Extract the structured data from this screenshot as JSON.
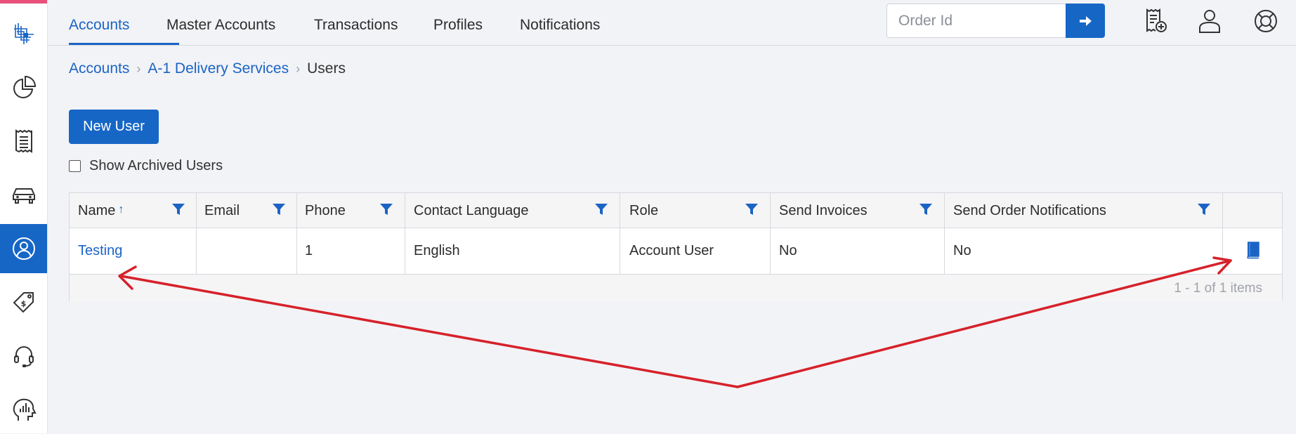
{
  "sidebar": {
    "items": [
      {
        "icon": "logo-icon"
      },
      {
        "icon": "pie-chart-icon"
      },
      {
        "icon": "receipt-icon"
      },
      {
        "icon": "car-icon"
      },
      {
        "icon": "user-circle-icon",
        "active": true
      },
      {
        "icon": "price-tag-icon"
      },
      {
        "icon": "headset-icon"
      },
      {
        "icon": "analytics-head-icon"
      }
    ]
  },
  "nav": {
    "tabs": [
      {
        "label": "Accounts",
        "active": true
      },
      {
        "label": "Master Accounts"
      },
      {
        "label": "Transactions"
      },
      {
        "label": "Profiles"
      },
      {
        "label": "Notifications"
      }
    ],
    "order_placeholder": "Order Id",
    "icons": [
      "add-receipt-icon",
      "user-icon",
      "help-lifebuoy-icon"
    ]
  },
  "breadcrumb": {
    "items": [
      "Accounts",
      "A-1 Delivery Services"
    ],
    "current": "Users"
  },
  "new_user_label": "New User",
  "show_archived_label": "Show Archived Users",
  "show_archived_checked": false,
  "grid": {
    "columns": [
      "Name",
      "Email",
      "Phone",
      "Contact Language",
      "Role",
      "Send Invoices",
      "Send Order Notifications"
    ],
    "sort_column": "Name",
    "sort_direction": "ascending",
    "rows": [
      {
        "name": "Testing",
        "email": "",
        "phone": "1",
        "contact_language": "English",
        "role": "Account User",
        "send_invoices": "No",
        "send_order_notifications": "No"
      }
    ],
    "pager": "1 - 1 of 1 items"
  },
  "colors": {
    "primary": "#1666c6",
    "link": "#1b64c5",
    "accent_pink": "#e8507a",
    "annotation_red": "#d6212a"
  }
}
